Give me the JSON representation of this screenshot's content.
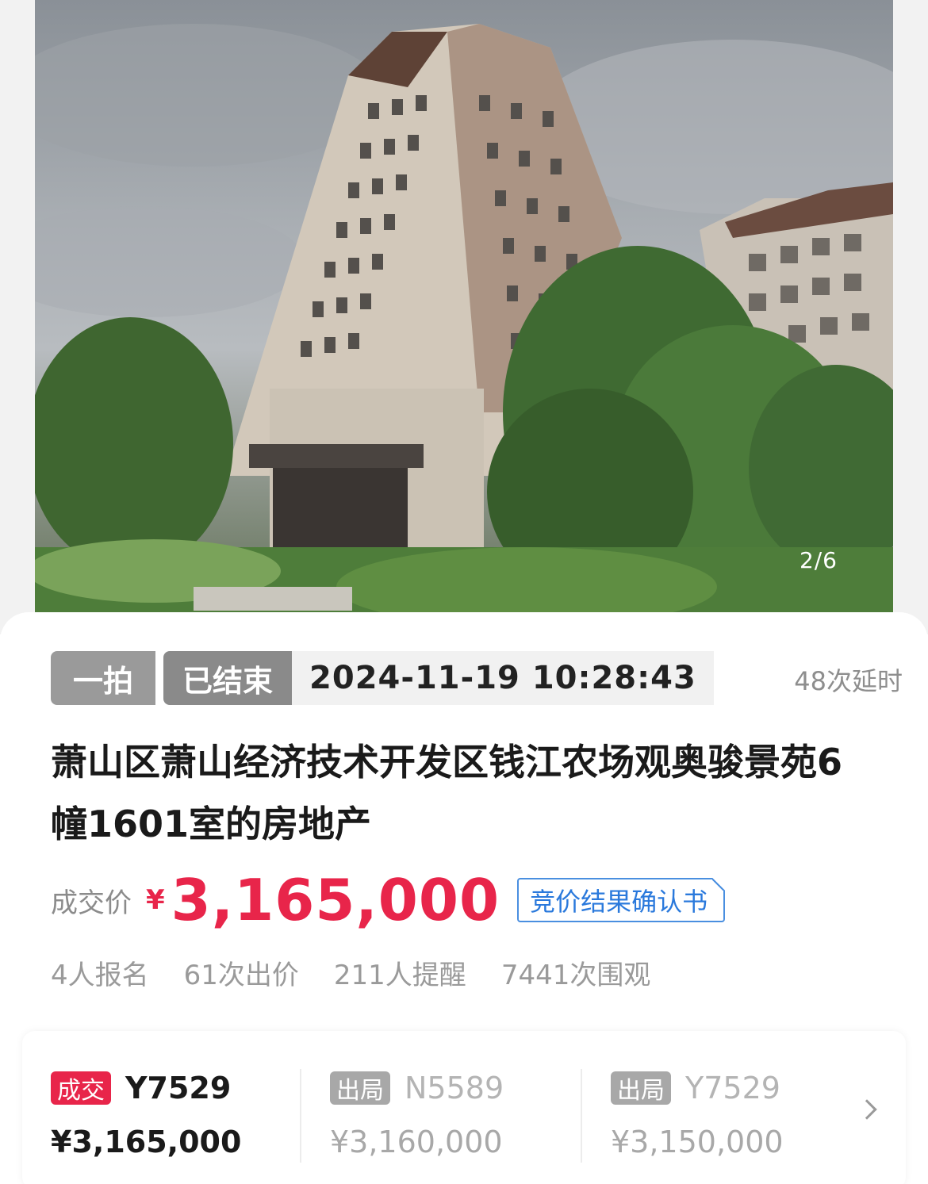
{
  "hero": {
    "counter": "2/6"
  },
  "auction": {
    "round_tag": "一拍",
    "status_tag": "已结束",
    "end_time": "2024-11-19 10:28:43",
    "delay_count": "48次延时",
    "title": "萧山区萧山经济技术开发区钱江农场观奥骏景苑6幢1601室的房地产",
    "price_label": "成交价",
    "currency": "¥",
    "price_value": "3,165,000",
    "confirm_doc_label": "竞价结果确认书"
  },
  "stats": [
    "4人报名",
    "61次出价",
    "211人提醒",
    "7441次围观"
  ],
  "bids": [
    {
      "status": "成交",
      "bidder": "Y7529",
      "amount": "¥3,165,000"
    },
    {
      "status": "出局",
      "bidder": "N5589",
      "amount": "¥3,160,000"
    },
    {
      "status": "出局",
      "bidder": "Y7529",
      "amount": "¥3,150,000"
    }
  ],
  "colors": {
    "price_red": "#e8254a",
    "link_blue": "#2a79dc",
    "tag_gray": "#9a9a9a"
  },
  "icons": {
    "more": "chevron-right-icon"
  }
}
